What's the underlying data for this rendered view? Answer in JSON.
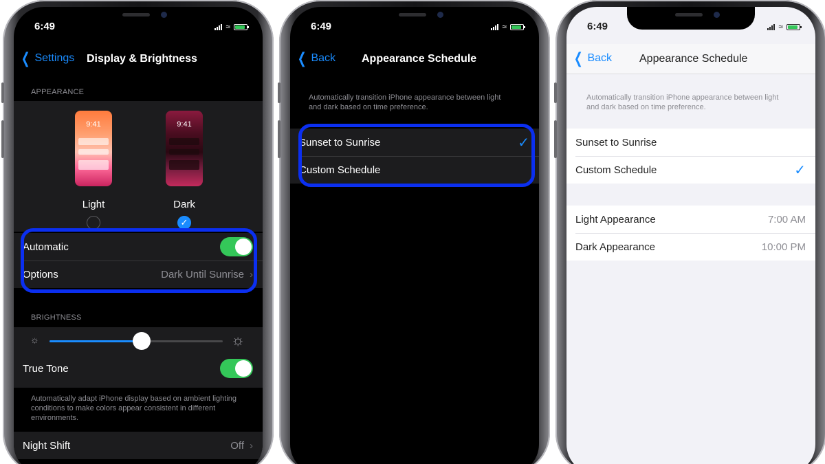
{
  "colors": {
    "accent": "#1a8cff",
    "toggle_on": "#34c759",
    "highlight": "#0b2ff0"
  },
  "phone1": {
    "status_time": "6:49",
    "nav": {
      "back_label": "Settings",
      "title": "Display & Brightness"
    },
    "appearance_header": "APPEARANCE",
    "light": {
      "preview_time": "9:41",
      "label": "Light",
      "selected": false
    },
    "dark": {
      "preview_time": "9:41",
      "label": "Dark",
      "selected": true
    },
    "automatic": {
      "label": "Automatic",
      "on": true
    },
    "options": {
      "label": "Options",
      "value": "Dark Until Sunrise"
    },
    "brightness_header": "BRIGHTNESS",
    "brightness_level": 0.53,
    "true_tone": {
      "label": "True Tone",
      "on": true
    },
    "true_tone_note": "Automatically adapt iPhone display based on ambient lighting conditions to make colors appear consistent in different environments.",
    "night_shift": {
      "label": "Night Shift",
      "value": "Off"
    }
  },
  "phone2": {
    "status_time": "6:49",
    "nav": {
      "back_label": "Back",
      "title": "Appearance Schedule"
    },
    "description": "Automatically transition iPhone appearance between light and dark based on time preference.",
    "options": [
      {
        "label": "Sunset to Sunrise",
        "checked": true
      },
      {
        "label": "Custom Schedule",
        "checked": false
      }
    ]
  },
  "phone3": {
    "status_time": "6:49",
    "nav": {
      "back_label": "Back",
      "title": "Appearance Schedule"
    },
    "description": "Automatically transition iPhone appearance between light and dark based on time preference.",
    "options": [
      {
        "label": "Sunset to Sunrise",
        "checked": false
      },
      {
        "label": "Custom Schedule",
        "checked": true
      }
    ],
    "times": [
      {
        "label": "Light Appearance",
        "value": "7:00 AM"
      },
      {
        "label": "Dark Appearance",
        "value": "10:00 PM"
      }
    ]
  }
}
